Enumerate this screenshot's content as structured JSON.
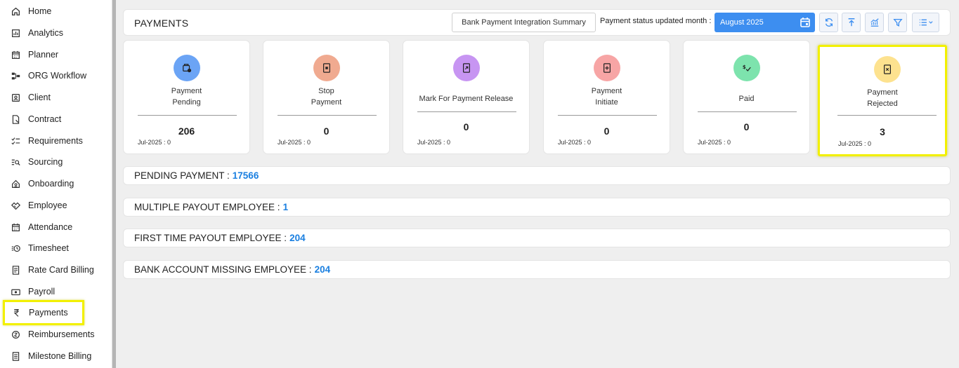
{
  "sidebar": {
    "items": [
      {
        "label": "Home",
        "icon": "home-icon"
      },
      {
        "label": "Analytics",
        "icon": "analytics-icon"
      },
      {
        "label": "Planner",
        "icon": "calendar-icon"
      },
      {
        "label": "ORG Workflow",
        "icon": "workflow-icon"
      },
      {
        "label": "Client",
        "icon": "client-icon"
      },
      {
        "label": "Contract",
        "icon": "contract-icon"
      },
      {
        "label": "Requirements",
        "icon": "checklist-icon"
      },
      {
        "label": "Sourcing",
        "icon": "search-list-icon"
      },
      {
        "label": "Onboarding",
        "icon": "onboarding-icon"
      },
      {
        "label": "Employee",
        "icon": "handshake-icon"
      },
      {
        "label": "Attendance",
        "icon": "calendar-icon"
      },
      {
        "label": "Timesheet",
        "icon": "clock-list-icon"
      },
      {
        "label": "Rate Card Billing",
        "icon": "receipt-icon"
      },
      {
        "label": "Payroll",
        "icon": "cash-icon"
      },
      {
        "label": "Payments",
        "icon": "rupee-icon"
      },
      {
        "label": "Reimbursements",
        "icon": "refund-icon"
      },
      {
        "label": "Milestone Billing",
        "icon": "document-icon"
      }
    ],
    "active_item": "Payments"
  },
  "header": {
    "title": "PAYMENTS",
    "summary_button": "Bank Payment Integration Summary",
    "status_label": "Payment status updated month :",
    "month_value": "August 2025"
  },
  "cards": [
    {
      "line1": "Payment",
      "line2": "Pending",
      "count": "206",
      "sub": "Jul-2025 : 0",
      "color": "#6ba4f5",
      "icon": "wallet-clock-icon"
    },
    {
      "line1": "Stop",
      "line2": "Payment",
      "count": "0",
      "sub": "Jul-2025 : 0",
      "color": "#f0aa90",
      "icon": "doc-stop-icon"
    },
    {
      "line1": "Mark For Payment Release",
      "line2": "",
      "count": "0",
      "sub": "Jul-2025 : 0",
      "color": "#c795f2",
      "icon": "doc-release-icon"
    },
    {
      "line1": "Payment",
      "line2": "Initiate",
      "count": "0",
      "sub": "Jul-2025 : 0",
      "color": "#f7a5a5",
      "icon": "doc-plus-icon"
    },
    {
      "line1": "Paid",
      "line2": "",
      "count": "0",
      "sub": "Jul-2025 : 0",
      "color": "#7de3ad",
      "icon": "dollar-check-icon"
    },
    {
      "line1": "Payment",
      "line2": "Rejected",
      "count": "3",
      "sub": "Jul-2025 : 0",
      "color": "#fde28f",
      "icon": "doc-x-icon"
    }
  ],
  "rows": [
    {
      "label": "PENDING PAYMENT :",
      "value": "17566"
    },
    {
      "label": "MULTIPLE PAYOUT EMPLOYEE :",
      "value": "1"
    },
    {
      "label": "FIRST TIME PAYOUT EMPLOYEE :",
      "value": "204"
    },
    {
      "label": "BANK ACCOUNT MISSING EMPLOYEE :",
      "value": "204"
    }
  ],
  "colors": {
    "accent": "#3d8ef0",
    "highlight": "#f2f000",
    "value_blue": "#1a7fe0"
  }
}
